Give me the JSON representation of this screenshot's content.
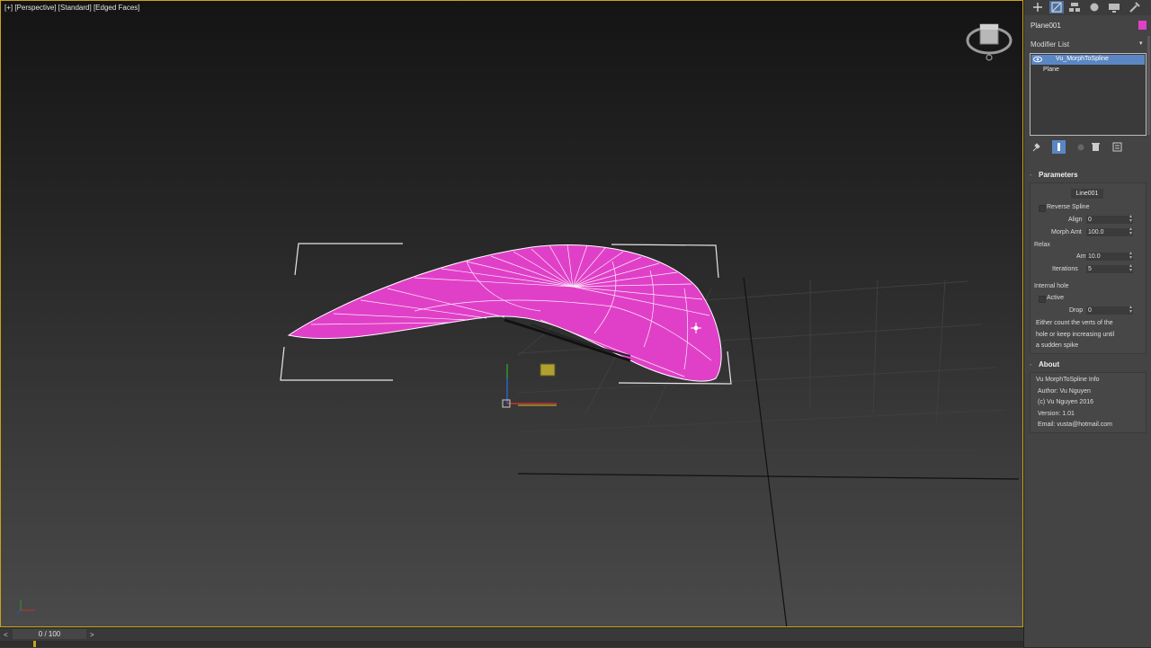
{
  "viewport": {
    "label": "[+] [Perspective] [Standard] [Edged Faces]",
    "accent_color": "#c9a21c",
    "object_color": "#e040c8"
  },
  "timeline": {
    "counter": "0 / 100",
    "prev_label": "<",
    "next_label": ">"
  },
  "command_panel": {
    "tabs": [
      "create-icon",
      "modify-icon",
      "hierarchy-icon",
      "motion-icon",
      "display-icon",
      "utilities-icon"
    ],
    "object_name": "Plane001",
    "object_color": "#e040c8",
    "modifier_list_label": "Modifier List",
    "stack": [
      "Vu_MorphToSpline",
      "Plane"
    ],
    "stack_toolbar": [
      "pin-stack-icon",
      "show-end-result-icon",
      "make-unique-icon",
      "remove-modifier-icon",
      "configure-sets-icon"
    ],
    "parameters": {
      "title": "Parameters",
      "pick_button": "Line001",
      "reverse_spline_label": "Reverse Spline",
      "align_label": "Align",
      "align_value": "0",
      "morph_amt_label": "Morph Amt",
      "morph_amt_value": "100.0",
      "relax_group": "Relax",
      "amt_label": "Amt",
      "amt_value": "10.0",
      "iterations_label": "Iterations",
      "iterations_value": "5",
      "internal_hole_group": "Internal hole",
      "active_label": "Active",
      "drop_label": "Drop",
      "drop_value": "0",
      "note_lines": [
        "Either count the verts of the",
        "hole or keep increasing until",
        "a sudden spike"
      ]
    },
    "about": {
      "title": "About",
      "lines": [
        "Vu MorphToSpline Info",
        "Author: Vu Nguyen",
        "(c) Vu Nguyen 2016",
        "Version: 1.01",
        "Email: vusta@hotmail.com"
      ]
    }
  }
}
